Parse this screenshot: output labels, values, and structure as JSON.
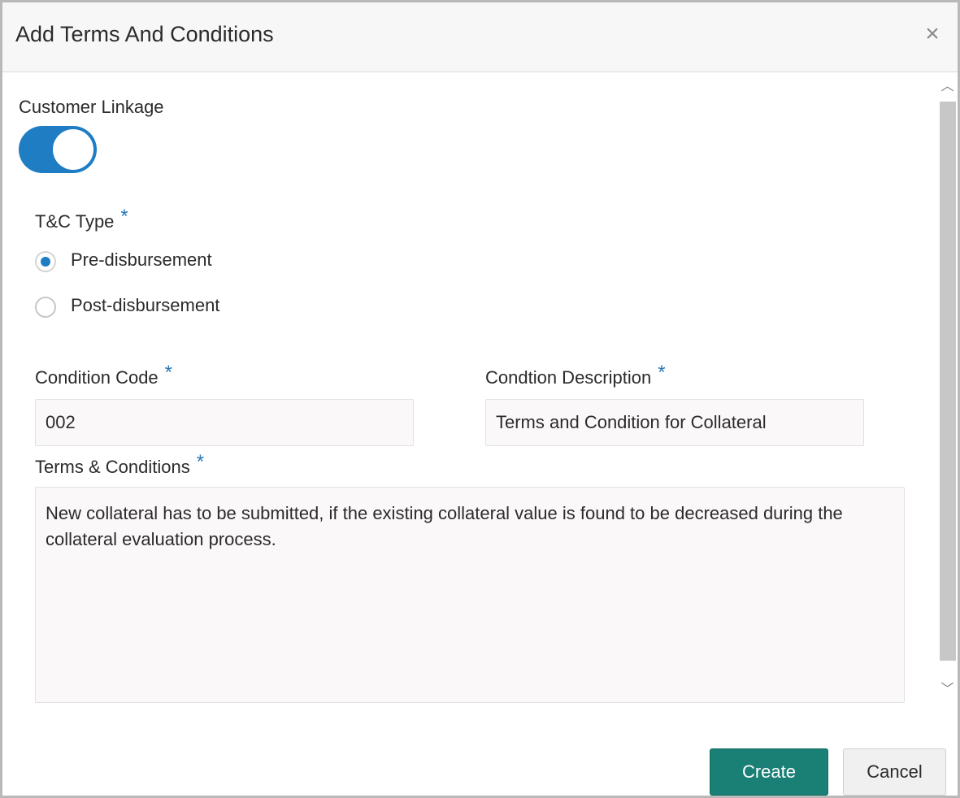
{
  "dialog": {
    "title": "Add Terms And Conditions",
    "close_icon": "close-icon"
  },
  "customer_linkage": {
    "label": "Customer Linkage",
    "enabled": true
  },
  "tc_type": {
    "label": "T&C Type",
    "required_mark": "*",
    "options": [
      {
        "label": "Pre-disbursement",
        "selected": true
      },
      {
        "label": "Post-disbursement",
        "selected": false
      }
    ]
  },
  "condition_code": {
    "label": "Condition Code",
    "required_mark": "*",
    "value": "002"
  },
  "condition_description": {
    "label": "Condtion Description",
    "required_mark": "*",
    "value": "Terms and Condition for Collateral"
  },
  "terms_conditions": {
    "label": "Terms & Conditions",
    "required_mark": "*",
    "value": "New collateral has to be submitted, if the existing collateral value is found to be decreased during the collateral evaluation process."
  },
  "buttons": {
    "create": "Create",
    "cancel": "Cancel"
  },
  "colors": {
    "accent": "#1e7dc3",
    "create_button": "#1a7f74",
    "required_star": "#2a78b6"
  }
}
